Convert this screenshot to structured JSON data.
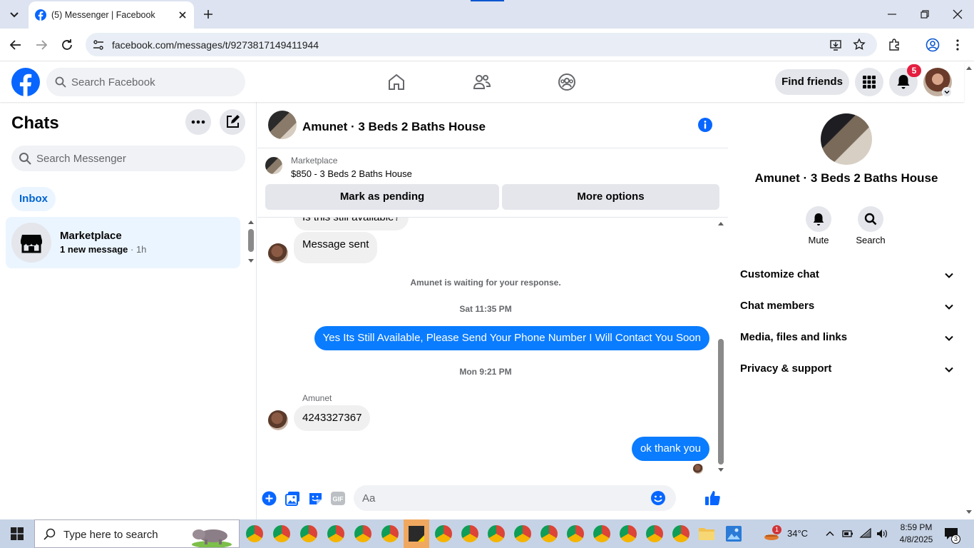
{
  "browser": {
    "tab_title": "(5) Messenger | Facebook",
    "url": "facebook.com/messages/t/9273817149411944"
  },
  "fb_header": {
    "search_placeholder": "Search Facebook",
    "find_friends": "Find friends",
    "notification_count": "5"
  },
  "left": {
    "title": "Chats",
    "search_placeholder": "Search Messenger",
    "inbox_label": "Inbox",
    "chat_item": {
      "name": "Marketplace",
      "preview": "1 new message",
      "time": " · 1h"
    }
  },
  "conversation": {
    "name": "Amunet · 3 Beds 2 Baths House",
    "marketplace_label": "Marketplace",
    "listing": "$850 - 3 Beds 2 Baths House",
    "mark_pending": "Mark as pending",
    "more_options": "More options",
    "messages": {
      "partial_in": "Is this still available?",
      "sent_in": "Message sent",
      "waiting": "Amunet is waiting for your response.",
      "time1": "Sat 11:35 PM",
      "out1": "Yes Its Still Available, Please Send Your Phone Number I Will Contact You Soon",
      "time2": "Mon 9:21 PM",
      "sender": "Amunet",
      "in2": "4243327367",
      "out2": "ok thank you"
    },
    "composer_placeholder": "Aa"
  },
  "right": {
    "name": "Amunet · 3 Beds 2 Baths House",
    "mute": "Mute",
    "search": "Search",
    "sections": [
      "Customize chat",
      "Chat members",
      "Media, files and links",
      "Privacy & support"
    ]
  },
  "taskbar": {
    "search_placeholder": "Type here to search",
    "weather": "34°C",
    "weather_badge": "1",
    "time": "8:59 PM",
    "date": "4/8/2025",
    "notif_count": "3"
  },
  "colors": {
    "fb_blue": "#0866ff",
    "messenger_blue": "#0a7cff",
    "selected_bg": "#ebf5ff",
    "notif_red": "#e41e3f"
  }
}
